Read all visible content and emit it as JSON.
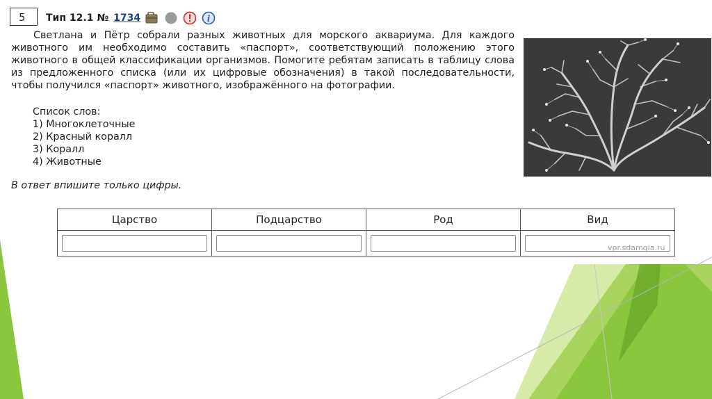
{
  "task": {
    "number": "5",
    "type_label": "Тип 12.1 №",
    "task_id": "1734",
    "text": "Светлана и Пётр собрали разных животных для морского аквариума. Для каждого животного им необходимо составить «паспорт», соответствующий положению этого животного в общей классификации организмов. Помогите ребятам записать в таблицу слова из предложенного списка (или их цифровые обозначения) в такой последовательности, чтобы получился «паспорт» животного, изображённого на фотографии.",
    "list_title": "Список слов:",
    "words": [
      "1) Многоклеточные",
      "2) Красный коралл",
      "3) Коралл",
      "4) Животные"
    ],
    "answer_note": "В ответ впишите только цифры."
  },
  "table": {
    "headers": [
      "Царство",
      "Подцарство",
      "Род",
      "Вид"
    ],
    "values": [
      "",
      "",
      "",
      ""
    ]
  },
  "watermark": "vpr.sdamgia.ru",
  "icons": [
    "briefcase-icon",
    "gray-circle-icon",
    "warning-icon",
    "info-icon"
  ],
  "colors": {
    "accent_green": "#8cc63f",
    "dark_green": "#6aa82a",
    "light_green": "#cfe59a",
    "link_blue": "#1a3f8c"
  }
}
